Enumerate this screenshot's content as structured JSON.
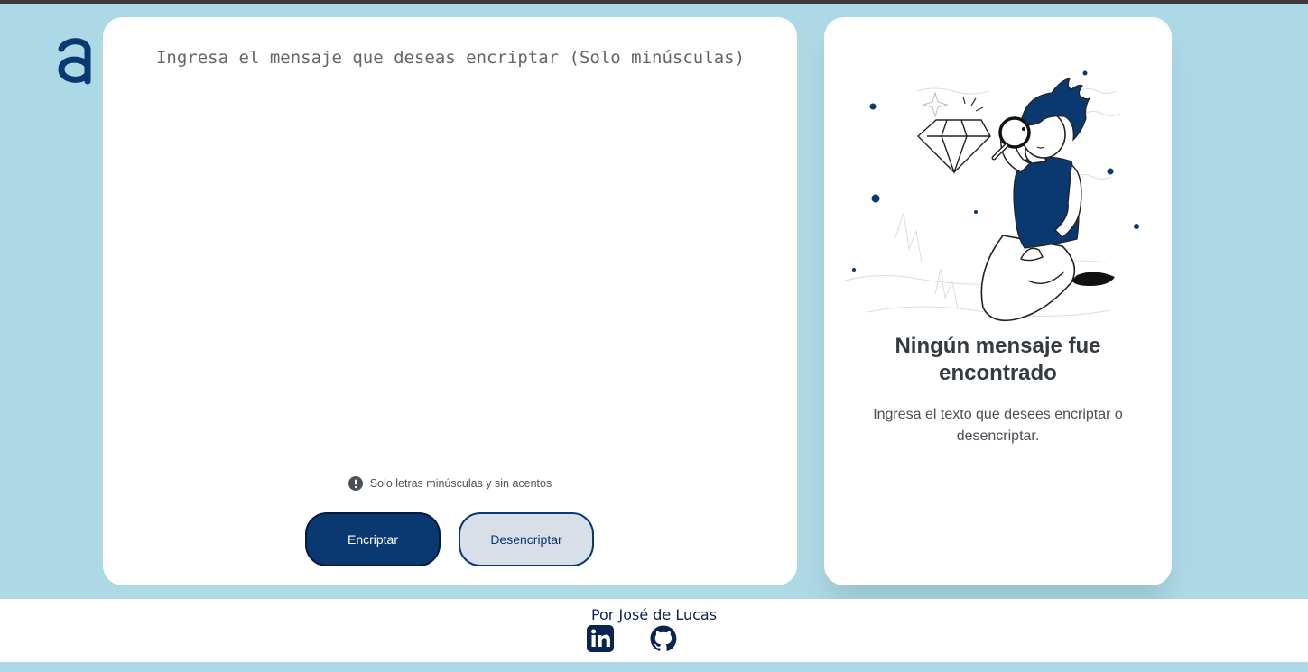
{
  "app": {
    "logo_icon": "alura-a-logo-icon",
    "accent_color": "#0a3871",
    "background_color": "#add8e6"
  },
  "encrypt_panel": {
    "input_placeholder": "Ingresa el mensaje que deseas encriptar (Solo minúsculas)",
    "input_value": "",
    "hint_icon": "info-icon",
    "hint_text": "Solo letras minúsculas y sin acentos",
    "encrypt_button_label": "Encriptar",
    "decrypt_button_label": "Desencriptar"
  },
  "output_panel": {
    "illustration": "person-with-magnifying-glass-diamond",
    "empty_title": "Ningún mensaje fue encontrado",
    "empty_description": "Ingresa el texto que desees encriptar o desencriptar."
  },
  "footer": {
    "author_text": "Por José de Lucas",
    "links": [
      {
        "icon": "linkedin-icon"
      },
      {
        "icon": "github-icon"
      }
    ]
  }
}
